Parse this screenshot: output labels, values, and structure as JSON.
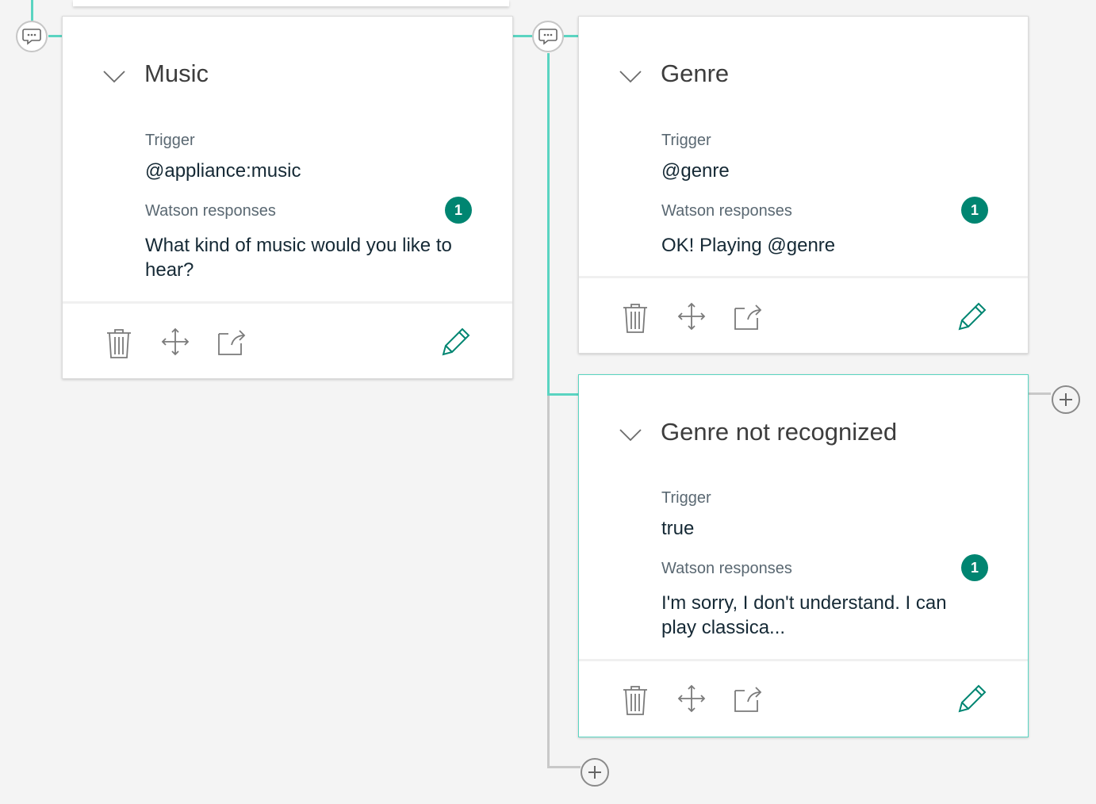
{
  "colors": {
    "accent": "#5ad4c1",
    "badge": "#008571",
    "edit_icon": "#008571",
    "tool_icon": "#7a7a7a",
    "connector_grey": "#c8c8c8"
  },
  "nodes": [
    {
      "title": "Music",
      "trigger_label": "Trigger",
      "trigger_value": "@appliance:music",
      "responses_label": "Watson responses",
      "responses_count": "1",
      "response_text": "What kind of music would you like to hear?",
      "icons": [
        "chevron-down-icon",
        "trash-icon",
        "move-icon",
        "jump-to-icon",
        "edit-pencil-icon"
      ]
    },
    {
      "title": "Genre",
      "trigger_label": "Trigger",
      "trigger_value": "@genre",
      "responses_label": "Watson responses",
      "responses_count": "1",
      "response_text": "OK! Playing @genre",
      "icons": [
        "chevron-down-icon",
        "trash-icon",
        "move-icon",
        "jump-to-icon",
        "edit-pencil-icon"
      ]
    },
    {
      "title": "Genre not recognized",
      "trigger_label": "Trigger",
      "trigger_value": "true",
      "responses_label": "Watson responses",
      "responses_count": "1",
      "response_text": "I'm sorry, I don't understand. I can play classica...",
      "selected": true,
      "icons": [
        "chevron-down-icon",
        "trash-icon",
        "move-icon",
        "jump-to-icon",
        "edit-pencil-icon"
      ]
    }
  ],
  "connectors": {
    "bubble_icon": "chat-bubble-icon",
    "add_icon": "plus-circle-icon"
  }
}
